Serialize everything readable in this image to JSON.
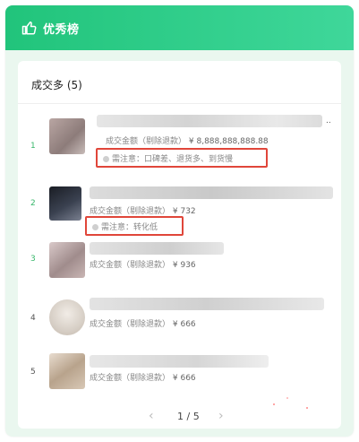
{
  "header": {
    "title": "优秀榜",
    "icon": "thumbs-up-icon"
  },
  "section": {
    "title": "成交多 (5)"
  },
  "colors": {
    "header_start": "#21c47b",
    "header_end": "#3fd79a",
    "rank_green": "#38b76b",
    "rank_gray": "#555555",
    "highlight_red": "#e0463a"
  },
  "rows": [
    {
      "rank": "1",
      "amount_label": "成交金额（剔除退款）",
      "amount_value": "¥ 8,888,888,888.88",
      "ellipsis": "..",
      "note": "需注意：口碑差、退货多、到货慢"
    },
    {
      "rank": "2",
      "amount_label": "成交金额（剔除退款）",
      "amount_value": "¥ 732",
      "note": "需注意：转化低"
    },
    {
      "rank": "3",
      "amount_label": "成交金额（剔除退款）",
      "amount_value": "¥ 936"
    },
    {
      "rank": "4",
      "amount_label": "成交金额（剔除退款）",
      "amount_value": "¥ 666"
    },
    {
      "rank": "5",
      "amount_label": "成交金额（剔除退款）",
      "amount_value": "¥ 666"
    }
  ],
  "pagination": {
    "prev_icon": "chevron-left-icon",
    "current": "1 / 5",
    "next_icon": "chevron-right-icon"
  }
}
